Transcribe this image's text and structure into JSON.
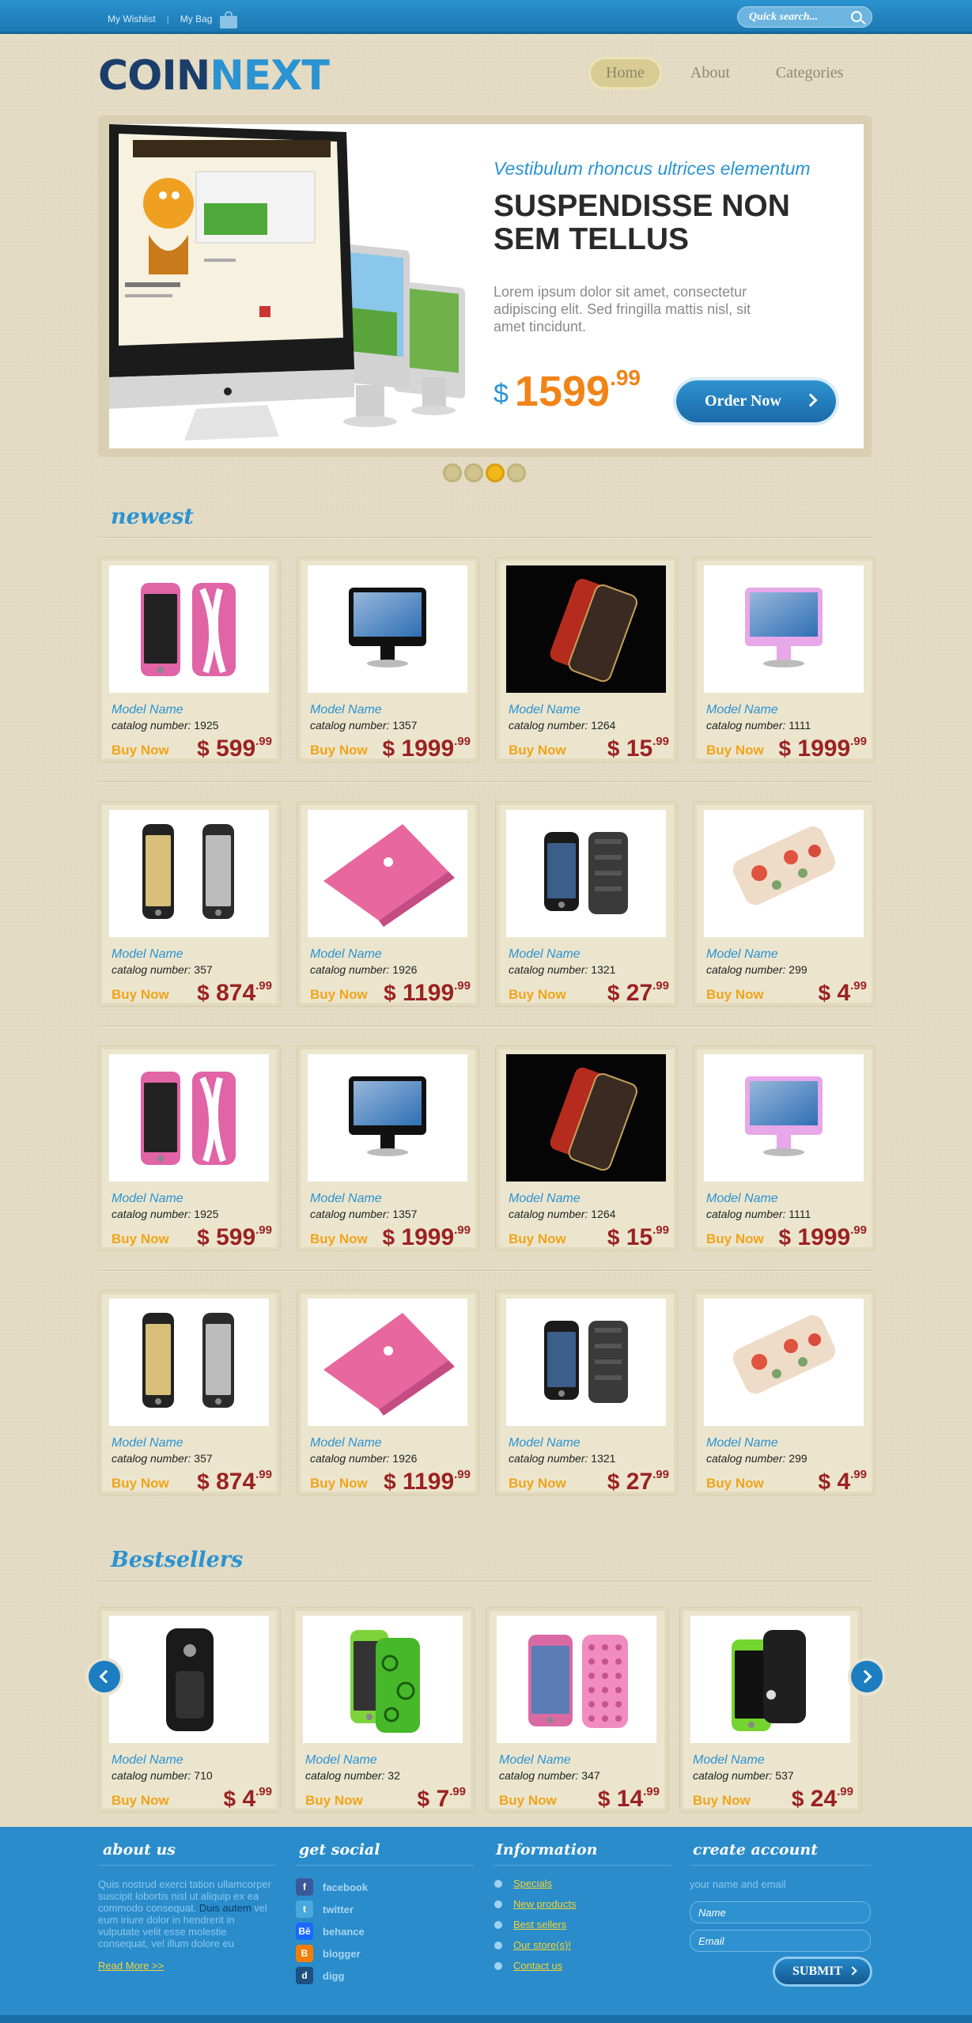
{
  "topbar": {
    "wishlist": "My Wishlist",
    "separator": "|",
    "bag": "My Bag",
    "search_placeholder": "Quick search..."
  },
  "logo": {
    "part1": "COIN",
    "part2": "NEXT"
  },
  "nav": [
    {
      "label": "Home",
      "active": true
    },
    {
      "label": "About",
      "active": false
    },
    {
      "label": "Categories",
      "active": false
    }
  ],
  "banner": {
    "subtitle": "Vestibulum rhoncus ultrices elementum",
    "title": "SUSPENDISSE NON SEM TELLUS",
    "text": "Lorem ipsum dolor sit amet, consectetur adipiscing elit. Sed fringilla mattis nisl, sit amet tincidunt.",
    "currency": "$",
    "price_int": "1599",
    "price_dec": ".99",
    "button": "Order Now",
    "slides": 4,
    "active_slide": 3
  },
  "sections": {
    "newest": "newest",
    "bestsellers": "Bestsellers"
  },
  "labels": {
    "model": "Model Name",
    "catalog_prefix": "catalog number:",
    "buy": "Buy Now",
    "currency": "$"
  },
  "newest": [
    {
      "img": "pink-iphone-case",
      "catalog": "1925",
      "int": "599",
      "dec": ".99"
    },
    {
      "img": "black-imac",
      "catalog": "1357",
      "int": "1999",
      "dec": ".99"
    },
    {
      "img": "red-iphone-dark",
      "catalog": "1264",
      "int": "15",
      "dec": ".99"
    },
    {
      "img": "pink-imac",
      "catalog": "1111",
      "int": "1999",
      "dec": ".99"
    },
    {
      "img": "iphone-pair",
      "catalog": "357",
      "int": "874",
      "dec": ".99"
    },
    {
      "img": "pink-macbook",
      "catalog": "1926",
      "int": "1199",
      "dec": ".99"
    },
    {
      "img": "black-iphone-case",
      "catalog": "1321",
      "int": "27",
      "dec": ".99"
    },
    {
      "img": "floral-iphone-case",
      "catalog": "299",
      "int": "4",
      "dec": ".99"
    },
    {
      "img": "pink-iphone-case",
      "catalog": "1925",
      "int": "599",
      "dec": ".99"
    },
    {
      "img": "black-imac",
      "catalog": "1357",
      "int": "1999",
      "dec": ".99"
    },
    {
      "img": "red-iphone-dark",
      "catalog": "1264",
      "int": "15",
      "dec": ".99"
    },
    {
      "img": "pink-imac",
      "catalog": "1111",
      "int": "1999",
      "dec": ".99"
    },
    {
      "img": "iphone-pair",
      "catalog": "357",
      "int": "874",
      "dec": ".99"
    },
    {
      "img": "pink-macbook",
      "catalog": "1926",
      "int": "1199",
      "dec": ".99"
    },
    {
      "img": "black-iphone-case",
      "catalog": "1321",
      "int": "27",
      "dec": ".99"
    },
    {
      "img": "floral-iphone-case",
      "catalog": "299",
      "int": "4",
      "dec": ".99"
    }
  ],
  "bestsellers": [
    {
      "img": "black-rugged-case",
      "catalog": "710",
      "int": "4",
      "dec": ".99"
    },
    {
      "img": "green-swirl-case",
      "catalog": "32",
      "int": "7",
      "dec": ".99"
    },
    {
      "img": "pink-dotted-case",
      "catalog": "347",
      "int": "14",
      "dec": ".99"
    },
    {
      "img": "green-bumper-case",
      "catalog": "537",
      "int": "24",
      "dec": ".99"
    }
  ],
  "footer": {
    "about": {
      "title": "about us",
      "text_before": "Quis nostrud exerci tation ullamcorper suscipit lobortis nisl ut aliquip ex ea commodo consequat. ",
      "text_highlight": "Duis autem",
      "text_after": " vel eum iriure dolor in hendrerit in vulputate velit esse molestie consequat, vel illum dolore eu",
      "read_more": "Read More >>"
    },
    "social": {
      "title": "get social",
      "items": [
        {
          "label": "facebook",
          "glyph": "f",
          "color": "#3b5998"
        },
        {
          "label": "twitter",
          "glyph": "t",
          "color": "#4aa9dc"
        },
        {
          "label": "behance",
          "glyph": "Bē",
          "color": "#1769ff"
        },
        {
          "label": "blogger",
          "glyph": "B",
          "color": "#f57d00"
        },
        {
          "label": "digg",
          "glyph": "d",
          "color": "#1d4f7f"
        }
      ]
    },
    "information": {
      "title": "Information",
      "items": [
        "Specials",
        "New products",
        "Best sellers",
        "Our store(s)!",
        "Contact us"
      ]
    },
    "account": {
      "title": "create account",
      "label": "your name and email",
      "name_placeholder": "Name",
      "email_placeholder": "Email",
      "submit": "SUBMIT"
    }
  }
}
